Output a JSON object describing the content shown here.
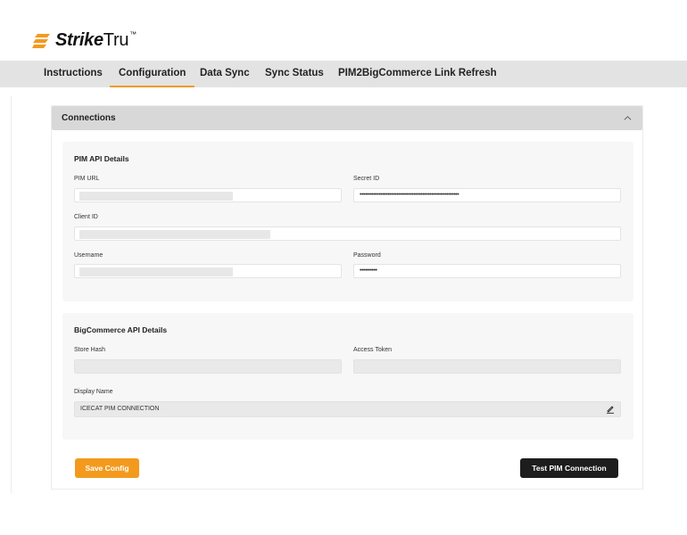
{
  "brand": {
    "name_bold": "Strike",
    "name_light": "Tru",
    "trademark": "™",
    "accent_color": "#f39a1e"
  },
  "nav": {
    "tabs": [
      {
        "label": "Instructions",
        "active": false
      },
      {
        "label": "Configuration",
        "active": true
      },
      {
        "label": "Data Sync",
        "active": false
      },
      {
        "label": "Sync Status",
        "active": false
      },
      {
        "label": "PIM2BigCommerce Link Refresh",
        "active": false
      }
    ]
  },
  "connections": {
    "title": "Connections",
    "expanded": true,
    "pim": {
      "title": "PIM API Details",
      "pim_url_label": "PIM URL",
      "secret_id_label": "Secret ID",
      "secret_id_value": "•••••••••••••••••••••••••••••••••••••••••••••••••••••••••",
      "client_id_label": "Client ID",
      "username_label": "Username",
      "password_label": "Password",
      "password_value": "••••••••••"
    },
    "bigcommerce": {
      "title": "BigCommerce API Details",
      "store_hash_label": "Store Hash",
      "access_token_label": "Access Token",
      "display_name_label": "Display Name",
      "display_name_value": "ICECAT PIM CONNECTION"
    }
  },
  "actions": {
    "save_label": "Save Config",
    "test_label": "Test PIM Connection"
  }
}
